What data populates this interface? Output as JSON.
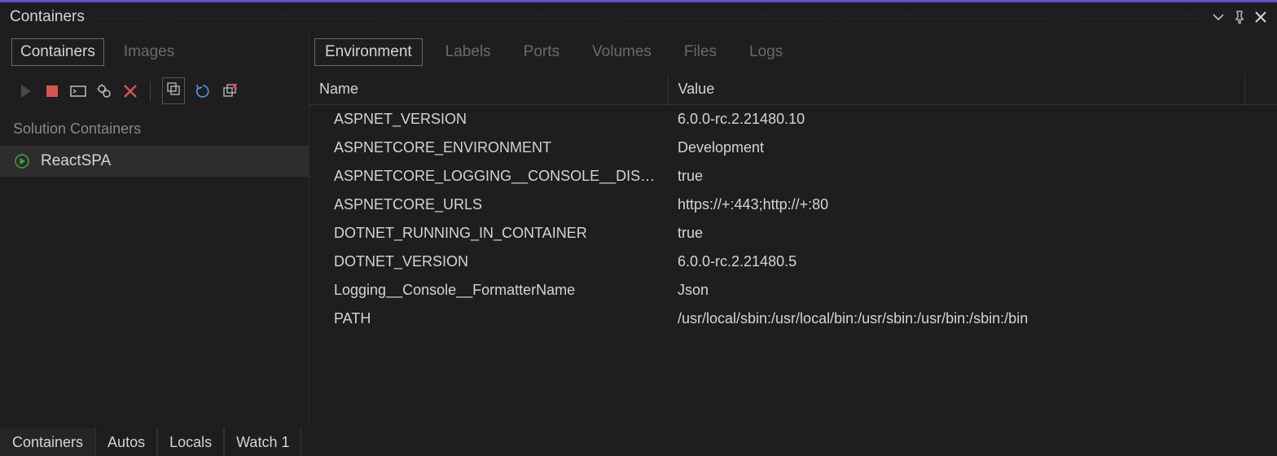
{
  "panel": {
    "title": "Containers"
  },
  "leftTabs": [
    {
      "label": "Containers",
      "active": true
    },
    {
      "label": "Images",
      "active": false
    }
  ],
  "sidebar": {
    "sectionHeader": "Solution Containers",
    "items": [
      {
        "label": "ReactSPA",
        "running": true
      }
    ]
  },
  "rightTabs": [
    {
      "label": "Environment",
      "active": true
    },
    {
      "label": "Labels",
      "active": false
    },
    {
      "label": "Ports",
      "active": false
    },
    {
      "label": "Volumes",
      "active": false
    },
    {
      "label": "Files",
      "active": false
    },
    {
      "label": "Logs",
      "active": false
    }
  ],
  "envTable": {
    "headers": {
      "name": "Name",
      "value": "Value"
    },
    "rows": [
      {
        "name": "ASPNET_VERSION",
        "value": "6.0.0-rc.2.21480.10"
      },
      {
        "name": "ASPNETCORE_ENVIRONMENT",
        "value": "Development"
      },
      {
        "name": "ASPNETCORE_LOGGING__CONSOLE__DISA…",
        "value": "true"
      },
      {
        "name": "ASPNETCORE_URLS",
        "value": "https://+:443;http://+:80"
      },
      {
        "name": "DOTNET_RUNNING_IN_CONTAINER",
        "value": "true"
      },
      {
        "name": "DOTNET_VERSION",
        "value": "6.0.0-rc.2.21480.5"
      },
      {
        "name": "Logging__Console__FormatterName",
        "value": "Json"
      },
      {
        "name": "PATH",
        "value": "/usr/local/sbin:/usr/local/bin:/usr/sbin:/usr/bin:/sbin:/bin"
      }
    ]
  },
  "bottomTabs": [
    {
      "label": "Containers",
      "active": true
    },
    {
      "label": "Autos",
      "active": false
    },
    {
      "label": "Locals",
      "active": false
    },
    {
      "label": "Watch 1",
      "active": false
    }
  ]
}
